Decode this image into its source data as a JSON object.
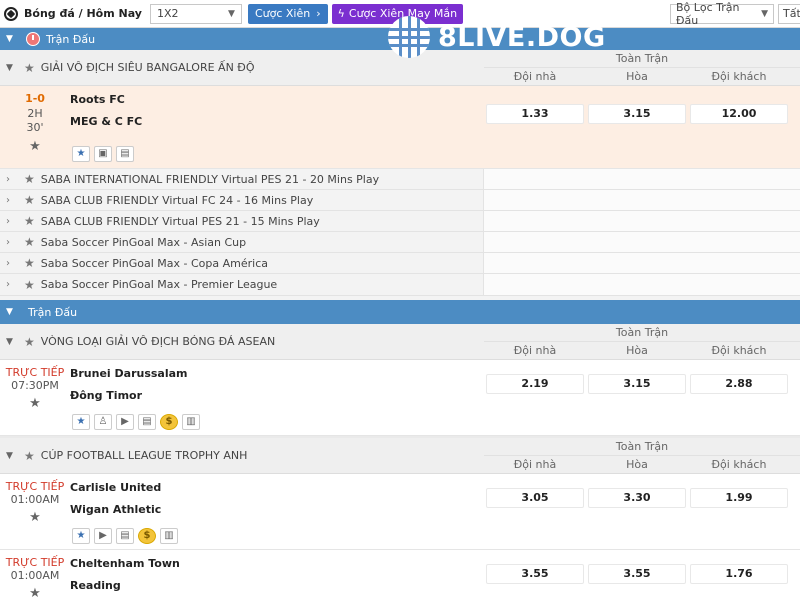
{
  "topbar": {
    "breadcrumb": "Bóng đá / Hôm Nay",
    "market_select": "1X2",
    "parlay_button": "Cược Xiên",
    "lucky_parlay_button": "Cược Xiên May Mắn",
    "filter_select": "Bộ Lọc Trận Đấu",
    "all_button": "Tất"
  },
  "logo_text": "8LIVE.DOG",
  "section1": {
    "title": "Trận Đấu"
  },
  "league1": {
    "name": "GIẢI VÔ ĐỊCH SIÊU BANGALORE ẤN ĐỘ",
    "market": "Toàn Trận",
    "cols": [
      "Đội nhà",
      "Hòa",
      "Đội khách"
    ],
    "match": {
      "score": "1-0",
      "period": "2H",
      "minute": "30'",
      "home": "Roots FC",
      "away": "MEG & C FC",
      "odds": [
        "1.33",
        "3.15",
        "12.00"
      ]
    }
  },
  "collapsed_leagues": [
    "SABA INTERNATIONAL FRIENDLY Virtual PES 21 - 20 Mins Play",
    "SABA CLUB FRIENDLY Virtual FC 24 - 16 Mins Play",
    "SABA CLUB FRIENDLY Virtual PES 21 - 15 Mins Play",
    "Saba Soccer PinGoal Max - Asian Cup",
    "Saba Soccer PinGoal Max - Copa América",
    "Saba Soccer PinGoal Max - Premier League"
  ],
  "section2": {
    "title": "Trận Đấu"
  },
  "league2": {
    "name": "VÒNG LOẠI GIẢI VÔ ĐỊCH BÓNG ĐÁ ASEAN",
    "market": "Toàn Trận",
    "cols": [
      "Đội nhà",
      "Hòa",
      "Đội khách"
    ],
    "match": {
      "live": "TRỰC TIẾP",
      "time": "07:30PM",
      "home": "Brunei Darussalam",
      "away": "Đông Timor",
      "odds": [
        "2.19",
        "3.15",
        "2.88"
      ]
    }
  },
  "league3": {
    "name": "CÚP FOOTBALL LEAGUE TROPHY ANH",
    "market": "Toàn Trận",
    "cols": [
      "Đội nhà",
      "Hòa",
      "Đội khách"
    ],
    "match1": {
      "live": "TRỰC TIẾP",
      "time": "01:00AM",
      "home": "Carlisle United",
      "away": "Wigan Athletic",
      "odds": [
        "3.05",
        "3.30",
        "1.99"
      ]
    },
    "match2": {
      "live": "TRỰC TIẾP",
      "time": "01:00AM",
      "home": "Cheltenham Town",
      "away": "Reading",
      "odds": [
        "3.55",
        "3.55",
        "1.76"
      ]
    }
  },
  "icons": {
    "coin_glyph": "$"
  }
}
